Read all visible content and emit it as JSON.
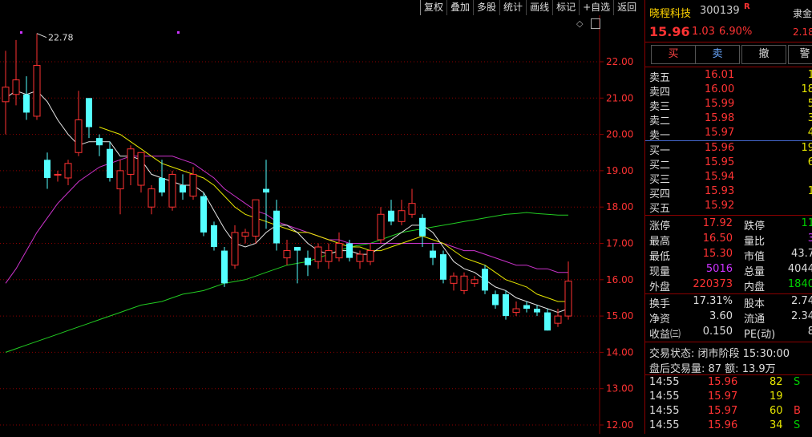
{
  "toolbar": [
    "复权",
    "叠加",
    "多股",
    "统计",
    "画线",
    "标记",
    "+自选",
    "返回"
  ],
  "chart": {
    "price_labels": [
      "22.00",
      "21.00",
      "20.00",
      "19.00",
      "18.00",
      "17.00",
      "16.00",
      "15.00",
      "14.00",
      "13.00",
      "12.00"
    ],
    "max_label": "22.78",
    "candles": [
      {
        "o": 20.9,
        "c": 21.3,
        "h": 22.3,
        "l": 20.0
      },
      {
        "o": 21.1,
        "c": 21.5,
        "h": 22.6,
        "l": 20.8
      },
      {
        "o": 21.1,
        "c": 20.6,
        "h": 21.6,
        "l": 20.4
      },
      {
        "o": 20.5,
        "c": 21.9,
        "h": 22.78,
        "l": 20.4
      },
      {
        "o": 19.3,
        "c": 18.8,
        "h": 19.5,
        "l": 18.5
      },
      {
        "o": 18.9,
        "c": 18.9,
        "h": 19.0,
        "l": 18.7
      },
      {
        "o": 18.8,
        "c": 19.2,
        "h": 19.3,
        "l": 18.6
      },
      {
        "o": 19.5,
        "c": 20.4,
        "h": 21.2,
        "l": 19.4
      },
      {
        "o": 21.0,
        "c": 20.2,
        "h": 21.0,
        "l": 19.9
      },
      {
        "o": 19.9,
        "c": 19.7,
        "h": 20.0,
        "l": 19.4
      },
      {
        "o": 19.6,
        "c": 18.8,
        "h": 19.8,
        "l": 18.7
      },
      {
        "o": 18.5,
        "c": 19.0,
        "h": 19.3,
        "l": 17.8
      },
      {
        "o": 18.9,
        "c": 19.6,
        "h": 19.7,
        "l": 18.6
      },
      {
        "o": 18.6,
        "c": 19.5,
        "h": 19.5,
        "l": 18.4
      },
      {
        "o": 18.0,
        "c": 18.5,
        "h": 18.6,
        "l": 17.8
      },
      {
        "o": 18.8,
        "c": 18.4,
        "h": 19.3,
        "l": 18.3
      },
      {
        "o": 18.0,
        "c": 18.9,
        "h": 19.0,
        "l": 17.9
      },
      {
        "o": 18.6,
        "c": 18.4,
        "h": 18.9,
        "l": 18.2
      },
      {
        "o": 18.3,
        "c": 18.9,
        "h": 19.1,
        "l": 18.2
      },
      {
        "o": 18.3,
        "c": 17.3,
        "h": 18.4,
        "l": 17.2
      },
      {
        "o": 17.5,
        "c": 16.9,
        "h": 17.6,
        "l": 16.8
      },
      {
        "o": 16.8,
        "c": 15.9,
        "h": 16.9,
        "l": 15.8
      },
      {
        "o": 16.4,
        "c": 17.3,
        "h": 17.5,
        "l": 16.3
      },
      {
        "o": 17.2,
        "c": 17.3,
        "h": 17.4,
        "l": 17.0
      },
      {
        "o": 17.2,
        "c": 18.2,
        "h": 18.2,
        "l": 17.0
      },
      {
        "o": 18.5,
        "c": 18.4,
        "h": 19.3,
        "l": 17.4
      },
      {
        "o": 17.9,
        "c": 17.0,
        "h": 18.2,
        "l": 16.8
      },
      {
        "o": 16.6,
        "c": 16.8,
        "h": 17.1,
        "l": 16.4
      },
      {
        "o": 16.9,
        "c": 16.8,
        "h": 16.9,
        "l": 15.9
      },
      {
        "o": 16.6,
        "c": 16.4,
        "h": 16.8,
        "l": 16.1
      },
      {
        "o": 16.5,
        "c": 16.9,
        "h": 17.0,
        "l": 16.3
      },
      {
        "o": 16.5,
        "c": 16.8,
        "h": 17.0,
        "l": 16.3
      },
      {
        "o": 16.6,
        "c": 17.0,
        "h": 17.3,
        "l": 16.5
      },
      {
        "o": 17.0,
        "c": 16.6,
        "h": 17.1,
        "l": 16.5
      },
      {
        "o": 16.5,
        "c": 16.7,
        "h": 16.8,
        "l": 16.3
      },
      {
        "o": 16.5,
        "c": 16.8,
        "h": 17.0,
        "l": 16.4
      },
      {
        "o": 17.1,
        "c": 17.8,
        "h": 18.0,
        "l": 17.0
      },
      {
        "o": 17.9,
        "c": 17.6,
        "h": 18.2,
        "l": 17.5
      },
      {
        "o": 17.6,
        "c": 17.9,
        "h": 18.2,
        "l": 17.5
      },
      {
        "o": 17.8,
        "c": 18.1,
        "h": 18.5,
        "l": 17.7
      },
      {
        "o": 17.7,
        "c": 17.2,
        "h": 17.8,
        "l": 16.9
      },
      {
        "o": 16.8,
        "c": 16.6,
        "h": 17.0,
        "l": 16.4
      },
      {
        "o": 16.7,
        "c": 16.0,
        "h": 16.8,
        "l": 15.9
      },
      {
        "o": 15.9,
        "c": 16.1,
        "h": 16.2,
        "l": 15.7
      },
      {
        "o": 15.7,
        "c": 16.1,
        "h": 16.2,
        "l": 15.6
      },
      {
        "o": 15.9,
        "c": 16.0,
        "h": 16.1,
        "l": 15.8
      },
      {
        "o": 16.3,
        "c": 15.7,
        "h": 16.4,
        "l": 15.6
      },
      {
        "o": 15.6,
        "c": 15.3,
        "h": 15.7,
        "l": 15.2
      },
      {
        "o": 15.6,
        "c": 15.0,
        "h": 15.7,
        "l": 14.9
      },
      {
        "o": 15.1,
        "c": 15.2,
        "h": 15.4,
        "l": 15.0
      },
      {
        "o": 15.3,
        "c": 15.2,
        "h": 15.4,
        "l": 15.1
      },
      {
        "o": 15.2,
        "c": 15.1,
        "h": 15.3,
        "l": 15.0
      },
      {
        "o": 15.1,
        "c": 14.6,
        "h": 15.2,
        "l": 14.6
      },
      {
        "o": 14.8,
        "c": 15.0,
        "h": 15.2,
        "l": 14.7
      },
      {
        "o": 15.0,
        "c": 15.96,
        "h": 16.5,
        "l": 14.9
      }
    ],
    "ma5": [
      21.0,
      21.2,
      21.1,
      21.2,
      20.9,
      20.4,
      20.0,
      19.7,
      19.8,
      19.8,
      19.8,
      19.4,
      19.4,
      19.3,
      18.9,
      18.8,
      18.7,
      18.6,
      18.6,
      18.4,
      17.9,
      17.4,
      17.0,
      16.9,
      17.0,
      17.3,
      17.5,
      17.5,
      17.3,
      17.0,
      16.8,
      16.7,
      16.8,
      16.8,
      16.7,
      16.7,
      16.9,
      17.1,
      17.3,
      17.5,
      17.5,
      17.3,
      16.9,
      16.5,
      16.3,
      16.2,
      16.0,
      15.8,
      15.7,
      15.5,
      15.4,
      15.3,
      15.2,
      15.1,
      15.2
    ],
    "ma10": [
      null,
      null,
      null,
      null,
      null,
      null,
      null,
      null,
      null,
      20.2,
      20.1,
      20.0,
      19.8,
      19.6,
      19.4,
      19.2,
      19.1,
      19.0,
      18.9,
      18.8,
      18.6,
      18.3,
      18.0,
      17.8,
      17.7,
      17.6,
      17.5,
      17.4,
      17.3,
      17.3,
      17.2,
      17.1,
      17.0,
      16.9,
      16.9,
      16.8,
      16.8,
      16.9,
      17.0,
      17.1,
      17.2,
      17.1,
      17.0,
      16.8,
      16.6,
      16.5,
      16.4,
      16.2,
      16.0,
      15.9,
      15.8,
      15.6,
      15.5,
      15.4,
      15.4
    ],
    "ma20": [
      15.9,
      16.3,
      16.8,
      17.3,
      17.7,
      18.1,
      18.4,
      18.7,
      18.9,
      19.1,
      19.2,
      19.3,
      19.4,
      19.4,
      19.4,
      19.4,
      19.4,
      19.3,
      19.2,
      19.0,
      18.8,
      18.5,
      18.3,
      18.1,
      17.9,
      17.8,
      17.6,
      17.5,
      17.4,
      17.3,
      17.2,
      17.1,
      17.1,
      17.0,
      17.0,
      17.0,
      17.0,
      17.0,
      17.0,
      17.0,
      17.0,
      17.0,
      17.0,
      16.9,
      16.8,
      16.8,
      16.7,
      16.6,
      16.5,
      16.4,
      16.4,
      16.3,
      16.3,
      16.2,
      16.2
    ],
    "ma60": [
      14.0,
      14.1,
      14.2,
      14.3,
      14.4,
      14.5,
      14.6,
      14.7,
      14.8,
      14.9,
      15.0,
      15.1,
      15.2,
      15.3,
      15.35,
      15.4,
      15.5,
      15.6,
      15.65,
      15.7,
      15.8,
      15.9,
      15.95,
      16.0,
      16.1,
      16.2,
      16.3,
      16.4,
      16.45,
      16.5,
      16.6,
      16.7,
      16.8,
      16.9,
      16.95,
      17.0,
      17.1,
      17.2,
      17.3,
      17.35,
      17.4,
      17.45,
      17.5,
      17.55,
      17.6,
      17.65,
      17.7,
      17.75,
      17.8,
      17.82,
      17.85,
      17.82,
      17.8,
      17.78,
      17.78
    ]
  },
  "quote": {
    "name": "晓程科技",
    "code": "300139",
    "flag": "R",
    "price": "15.96",
    "change": "1.03",
    "pct": "6.90%",
    "side_top": "隶金",
    "side_val": "2.18",
    "buy_btn": "买",
    "sell_btn": "卖",
    "cancel_btn": "撤",
    "alert_btn": "警"
  },
  "asks": [
    {
      "label": "卖五",
      "price": "16.01",
      "vol": "1"
    },
    {
      "label": "卖四",
      "price": "16.00",
      "vol": "18"
    },
    {
      "label": "卖三",
      "price": "15.99",
      "vol": "5"
    },
    {
      "label": "卖二",
      "price": "15.98",
      "vol": "3"
    },
    {
      "label": "卖一",
      "price": "15.97",
      "vol": "4"
    }
  ],
  "bids": [
    {
      "label": "买一",
      "price": "15.96",
      "vol": "19"
    },
    {
      "label": "买二",
      "price": "15.95",
      "vol": "6"
    },
    {
      "label": "买三",
      "price": "15.94",
      "vol": ""
    },
    {
      "label": "买四",
      "price": "15.93",
      "vol": "1"
    },
    {
      "label": "买五",
      "price": "15.92",
      "vol": ""
    }
  ],
  "stats1": [
    {
      "l1": "涨停",
      "v1": "17.92",
      "c1": "red",
      "l2": "跌停",
      "v2": "11",
      "c2": "green"
    },
    {
      "l1": "最高",
      "v1": "16.50",
      "c1": "red",
      "l2": "量比",
      "v2": "3",
      "c2": "purple"
    },
    {
      "l1": "最低",
      "v1": "15.30",
      "c1": "red",
      "l2": "市值",
      "v2": "43.7",
      "c2": "white"
    },
    {
      "l1": "现量",
      "v1": "5016",
      "c1": "purple",
      "l2": "总量",
      "v2": "4044",
      "c2": "white"
    },
    {
      "l1": "外盘",
      "v1": "220373",
      "c1": "red",
      "l2": "内盘",
      "v2": "1840",
      "c2": "green"
    }
  ],
  "stats2": [
    {
      "l1": "换手",
      "v1": "17.31%",
      "l2": "股本",
      "v2": "2.74"
    },
    {
      "l1": "净资",
      "v1": "3.60",
      "l2": "流通",
      "v2": "2.34"
    },
    {
      "l1": "收益㈢",
      "v1": "0.150",
      "l2": "PE(动)",
      "v2": "8"
    }
  ],
  "status": {
    "line1": "交易状态: 闭市阶段 15:30:00",
    "line2": "盘后交易量: 87  额: 13.9万"
  },
  "ticks": [
    {
      "t": "14:55",
      "p": "15.96",
      "v": "82",
      "s": "S",
      "sc": "green"
    },
    {
      "t": "14:55",
      "p": "15.97",
      "v": "19",
      "s": "",
      "sc": "white"
    },
    {
      "t": "14:55",
      "p": "15.97",
      "v": "60",
      "s": "B",
      "sc": "red"
    },
    {
      "t": "14:55",
      "p": "15.96",
      "v": "34",
      "s": "S",
      "sc": "green"
    }
  ]
}
